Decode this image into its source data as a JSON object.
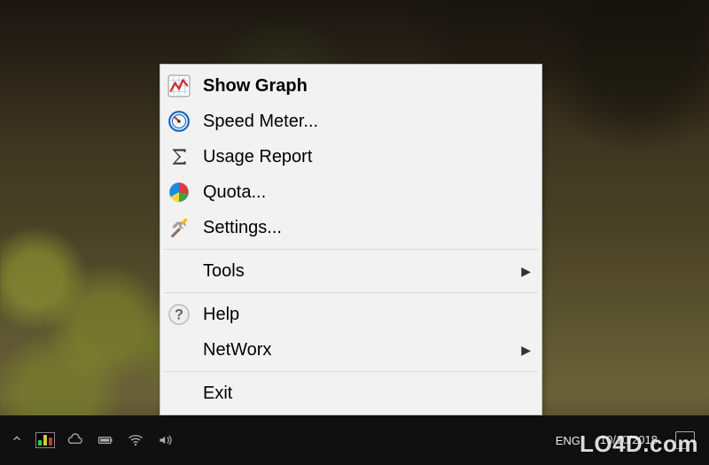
{
  "menu": {
    "items": [
      {
        "label": "Show Graph",
        "icon": "graph-icon",
        "bold": true,
        "submenu": false
      },
      {
        "label": "Speed Meter...",
        "icon": "gauge-icon",
        "bold": false,
        "submenu": false
      },
      {
        "label": "Usage Report",
        "icon": "sigma-icon",
        "bold": false,
        "submenu": false
      },
      {
        "label": "Quota...",
        "icon": "piechart-icon",
        "bold": false,
        "submenu": false
      },
      {
        "label": "Settings...",
        "icon": "tools-icon",
        "bold": false,
        "submenu": false
      },
      {
        "label": "Tools",
        "icon": null,
        "bold": false,
        "submenu": true,
        "sep_before": true
      },
      {
        "label": "Help",
        "icon": "help-icon",
        "bold": false,
        "submenu": false,
        "sep_before": true
      },
      {
        "label": "NetWorx",
        "icon": null,
        "bold": false,
        "submenu": true
      },
      {
        "label": "Exit",
        "icon": null,
        "bold": false,
        "submenu": false,
        "sep_before": true
      }
    ]
  },
  "taskbar": {
    "language": "ENG",
    "date": "10/10/2018"
  },
  "watermark": "LO4D.com"
}
